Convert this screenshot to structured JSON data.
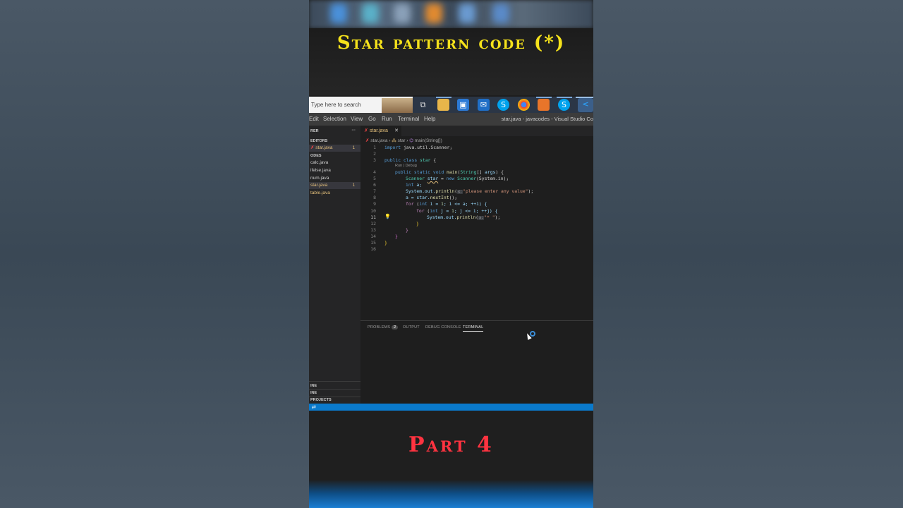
{
  "video": {
    "title": "Star pattern code (*)",
    "subtitle": "Part 4"
  },
  "taskbar": {
    "search_placeholder": "Type here to search",
    "icons": [
      "task-view-icon",
      "file-explorer-icon",
      "store-icon",
      "mail-icon",
      "skype-icon",
      "chrome-icon",
      "app-icon",
      "skype-notify-icon",
      "vscode-icon"
    ]
  },
  "menubar": {
    "items": [
      "Edit",
      "Selection",
      "View",
      "Go",
      "Run",
      "Terminal",
      "Help"
    ],
    "window_title": "star.java - javacodes - Visual Studio Co"
  },
  "sidebar": {
    "explorer_label": "RER",
    "open_editors_label": "EDITORS",
    "open_file": "star.java",
    "open_file_badge": "1",
    "folder_label": "ODES",
    "files": [
      {
        "name": "calc.java",
        "badge": ""
      },
      {
        "name": "ifelse.java",
        "badge": ""
      },
      {
        "name": "num.java",
        "badge": ""
      },
      {
        "name": "star.java",
        "badge": "1"
      },
      {
        "name": "table.java",
        "badge": ""
      }
    ],
    "outline_label": "INE",
    "timeline_label": "INE",
    "projects_label": "PROJECTS"
  },
  "editor": {
    "tab_label": "star.java",
    "breadcrumb": [
      "star.java",
      "star",
      "main(String[])"
    ],
    "codelens": "Run | Debug",
    "line_numbers": [
      "1",
      "2",
      "3",
      "4",
      "5",
      "6",
      "7",
      "8",
      "9",
      "10",
      "11",
      "12",
      "13",
      "14",
      "15",
      "16"
    ],
    "current_line": "11",
    "code": {
      "l1_a": "import",
      "l1_b": " java.util.Scanner;",
      "l3_a": "public class",
      "l3_b": " star",
      "l3_c": " {",
      "l4_a": "public static void",
      "l4_b": " main",
      "l4_c": "(",
      "l4_d": "String",
      "l4_e": "[] ",
      "l4_f": "args",
      "l4_g": ") {",
      "l5_a": "Scanner",
      "l5_b": "star",
      "l5_c": " = ",
      "l5_d": "new",
      "l5_e": " Scanner",
      "l5_f": "(System.in);",
      "l6_a": "int",
      "l6_b": " a;",
      "l7_a": "System.out.",
      "l7_b": "println",
      "l7_c": "(",
      "l7_hint": "x:",
      "l7_d": "\"please enter any value\"",
      "l7_e": ");",
      "l8_a": "a = star.",
      "l8_b": "nextInt",
      "l8_c": "();",
      "l9_a": "for",
      "l9_b": " (",
      "l9_c": "int",
      "l9_d": " i = ",
      "l9_e": "1",
      "l9_f": "; i <= a; ++i) {",
      "l10_a": "for",
      "l10_b": " (",
      "l10_c": "int",
      "l10_d": " j = ",
      "l10_e": "1",
      "l10_f": "; j <= i; ++j) {",
      "l11_a": "System.out.",
      "l11_b": "println",
      "l11_c": "(",
      "l11_hint": "x:",
      "l11_d": "\"* \"",
      "l11_e": ");",
      "l12": "}",
      "l13": "}",
      "l14": "}",
      "l15": "}"
    }
  },
  "panel": {
    "tabs": [
      "PROBLEMS",
      "OUTPUT",
      "DEBUG CONSOLE",
      "TERMINAL"
    ],
    "problems_count": "2",
    "active_tab": "TERMINAL"
  },
  "colors": {
    "title": "#f5e21b",
    "subtitle": "#ff3340",
    "statusbar": "#0a7acc"
  }
}
